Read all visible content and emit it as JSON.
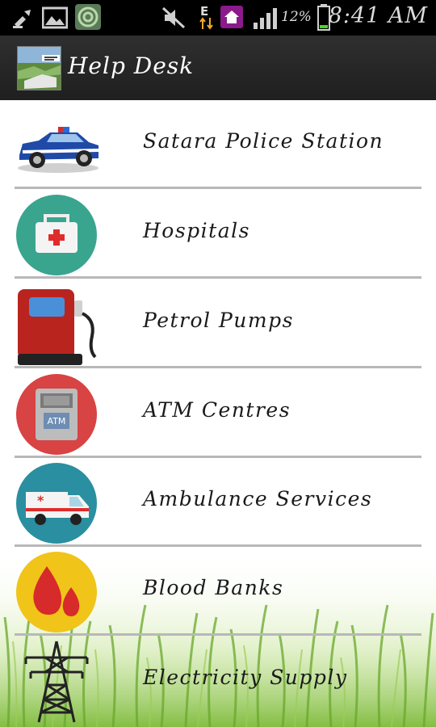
{
  "status_bar": {
    "time": "8:41 AM",
    "battery_percent": "12%",
    "icons": [
      "cleaner-icon",
      "gallery-icon",
      "target-app-icon",
      "mute-icon",
      "data-e-icon",
      "home-app-icon",
      "signal-icon",
      "battery-icon"
    ]
  },
  "action_bar": {
    "title": "Help Desk",
    "logo_icon": "app-logo-icon"
  },
  "colors": {
    "status_bar_bg": "#000000",
    "action_bar_bg": "#262626",
    "divider": "#b8b8b8",
    "hospital_circle": "#3aa58e",
    "atm_circle": "#d84343",
    "ambulance_circle": "#2a8fa0",
    "blood_circle": "#f0c419",
    "pump_red": "#b9241f"
  },
  "list": {
    "items": [
      {
        "label": "Satara Police Station",
        "icon": "police-car-icon"
      },
      {
        "label": "Hospitals",
        "icon": "first-aid-kit-icon"
      },
      {
        "label": "Petrol Pumps",
        "icon": "fuel-pump-icon"
      },
      {
        "label": "ATM Centres",
        "icon": "atm-machine-icon"
      },
      {
        "label": "Ambulance Services",
        "icon": "ambulance-icon"
      },
      {
        "label": "Blood Banks",
        "icon": "blood-drop-icon"
      },
      {
        "label": "Electricity Supply",
        "icon": "power-tower-icon"
      }
    ]
  }
}
